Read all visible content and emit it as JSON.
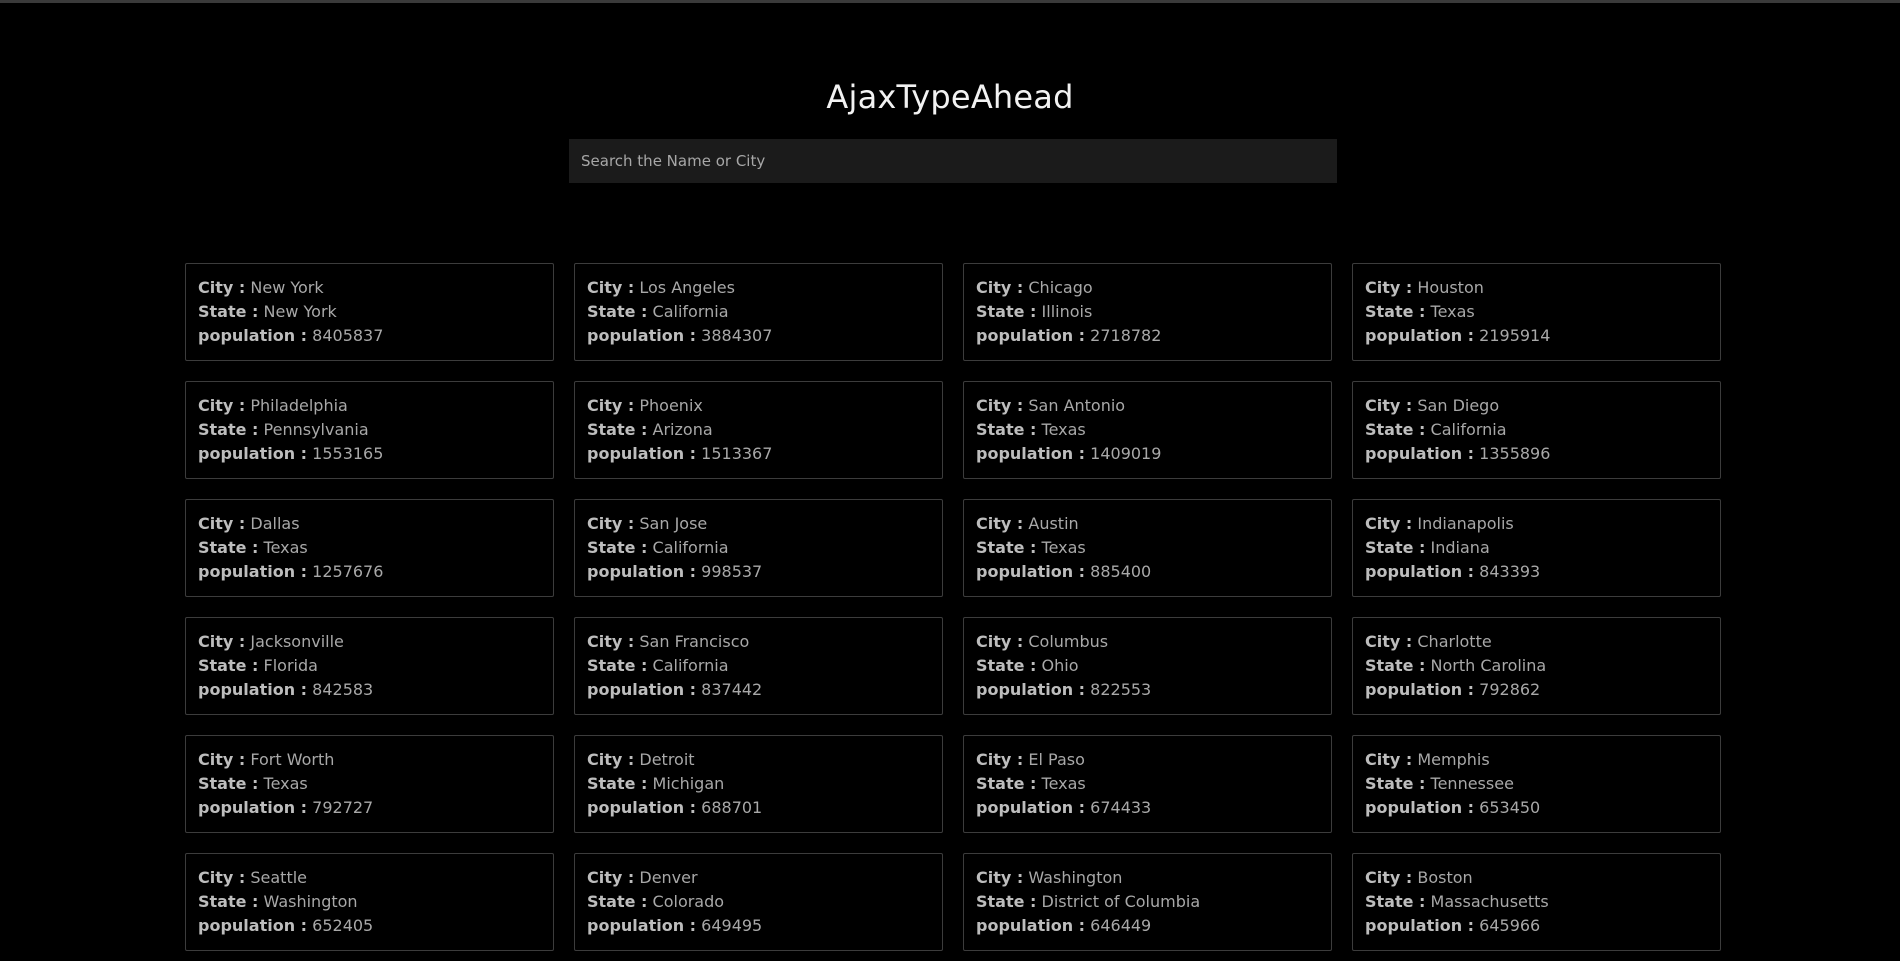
{
  "app": {
    "title": "AjaxTypeAhead"
  },
  "search": {
    "placeholder": "Search the Name or City",
    "value": ""
  },
  "labels": {
    "city": "City :",
    "state": "State :",
    "population": "population :"
  },
  "cities": [
    {
      "city": "New York",
      "state": "New York",
      "population": "8405837"
    },
    {
      "city": "Los Angeles",
      "state": "California",
      "population": "3884307"
    },
    {
      "city": "Chicago",
      "state": "Illinois",
      "population": "2718782"
    },
    {
      "city": "Houston",
      "state": "Texas",
      "population": "2195914"
    },
    {
      "city": "Philadelphia",
      "state": "Pennsylvania",
      "population": "1553165"
    },
    {
      "city": "Phoenix",
      "state": "Arizona",
      "population": "1513367"
    },
    {
      "city": "San Antonio",
      "state": "Texas",
      "population": "1409019"
    },
    {
      "city": "San Diego",
      "state": "California",
      "population": "1355896"
    },
    {
      "city": "Dallas",
      "state": "Texas",
      "population": "1257676"
    },
    {
      "city": "San Jose",
      "state": "California",
      "population": "998537"
    },
    {
      "city": "Austin",
      "state": "Texas",
      "population": "885400"
    },
    {
      "city": "Indianapolis",
      "state": "Indiana",
      "population": "843393"
    },
    {
      "city": "Jacksonville",
      "state": "Florida",
      "population": "842583"
    },
    {
      "city": "San Francisco",
      "state": "California",
      "population": "837442"
    },
    {
      "city": "Columbus",
      "state": "Ohio",
      "population": "822553"
    },
    {
      "city": "Charlotte",
      "state": "North Carolina",
      "population": "792862"
    },
    {
      "city": "Fort Worth",
      "state": "Texas",
      "population": "792727"
    },
    {
      "city": "Detroit",
      "state": "Michigan",
      "population": "688701"
    },
    {
      "city": "El Paso",
      "state": "Texas",
      "population": "674433"
    },
    {
      "city": "Memphis",
      "state": "Tennessee",
      "population": "653450"
    },
    {
      "city": "Seattle",
      "state": "Washington",
      "population": "652405"
    },
    {
      "city": "Denver",
      "state": "Colorado",
      "population": "649495"
    },
    {
      "city": "Washington",
      "state": "District of Columbia",
      "population": "646449"
    },
    {
      "city": "Boston",
      "state": "Massachusetts",
      "population": "645966"
    }
  ],
  "colors": {
    "background": "#000000",
    "title": "#f2f2f2",
    "search_bg": "#1b1b1b",
    "card_border": "#3c3c3c",
    "text": "#a8a8a8"
  }
}
